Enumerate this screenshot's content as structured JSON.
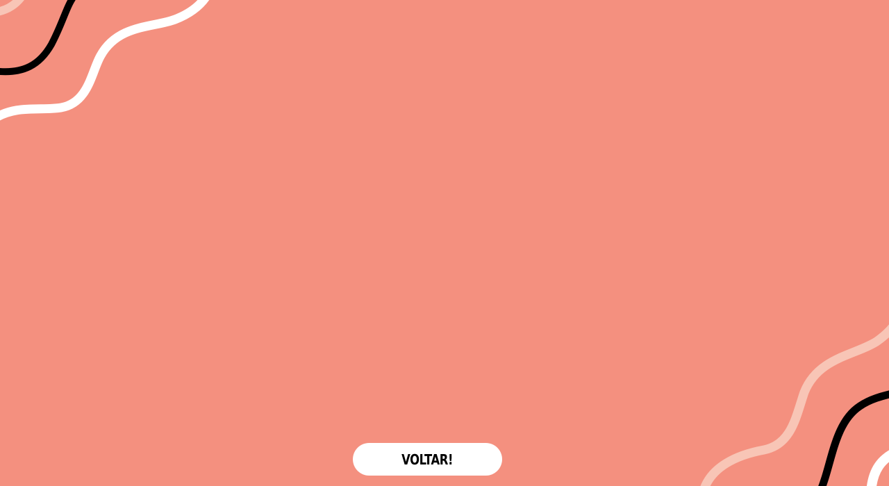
{
  "colors": {
    "background": "#F4907F",
    "wave_light_pink": "#F8C5B6",
    "wave_black": "#000000",
    "wave_white": "#FFFFFF",
    "button_bg": "#FFFFFF",
    "button_text": "#000000"
  },
  "decorations": {
    "top_left_icon": "wavy-lines-icon",
    "bottom_right_icon": "wavy-lines-icon"
  },
  "back_button": {
    "label": "VOLTAR!"
  }
}
